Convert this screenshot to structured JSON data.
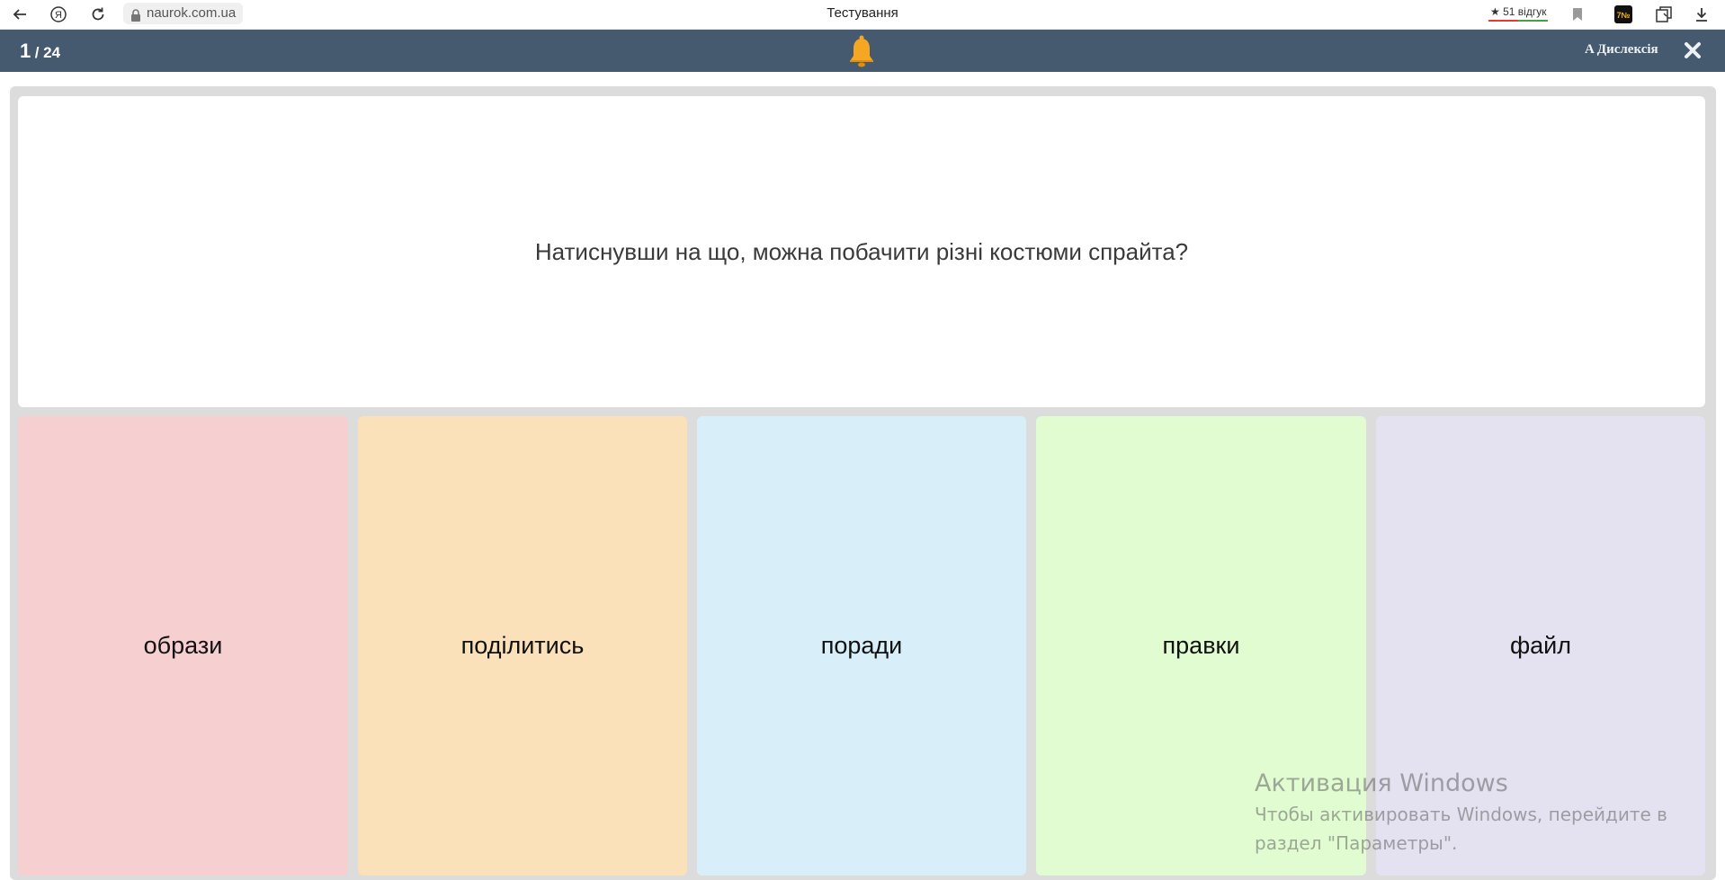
{
  "browser": {
    "url": "naurok.com.ua",
    "tab_title": "Тестування",
    "reviews": "51 відгук",
    "icons": [
      "back-arrow-icon",
      "yandex-icon",
      "reload-icon",
      "lock-icon",
      "bookmark-icon",
      "extension-icon",
      "collections-icon",
      "download-icon"
    ]
  },
  "header": {
    "current": "1",
    "total": "/ 24",
    "dyslexia_label": "A Дислексія",
    "accent": "#455a6e",
    "bell_color": "#f5a623"
  },
  "question": {
    "text": "Натиснувши на що, можна побачити різні костюми спрайта?"
  },
  "answers": [
    {
      "label": "образи",
      "color": "#f6cfd1"
    },
    {
      "label": "поділитись",
      "color": "#fae1b9"
    },
    {
      "label": "поради",
      "color": "#d8eff9"
    },
    {
      "label": "правки",
      "color": "#e0fcd0"
    },
    {
      "label": "файл",
      "color": "#e4e2f1"
    }
  ],
  "watermark": {
    "title": "Активация Windows",
    "line1": "Чтобы активировать Windows, перейдите в",
    "line2": "раздел \"Параметры\"."
  }
}
